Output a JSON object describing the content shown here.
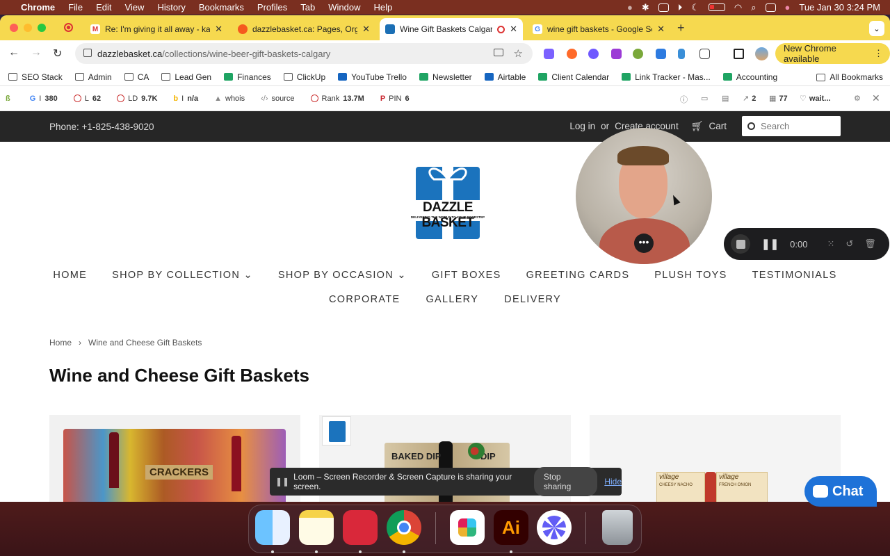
{
  "menubar": {
    "app": "Chrome",
    "items": [
      "File",
      "Edit",
      "View",
      "History",
      "Bookmarks",
      "Profiles",
      "Tab",
      "Window",
      "Help"
    ],
    "datetime": "Tue Jan 30  3:24 PM"
  },
  "tabs": [
    {
      "title": "Re: I'm giving it all away - kai",
      "icon": "gmail-icon"
    },
    {
      "title": "dazzlebasket.ca: Pages, Orga",
      "icon": "seo-tool-icon"
    },
    {
      "title": "Wine Gift Baskets Calgary",
      "icon": "dazzle-basket-icon"
    },
    {
      "title": "wine gift baskets - Google Se",
      "icon": "google-icon"
    }
  ],
  "address": {
    "domain": "dazzlebasket.ca",
    "path": "/collections/wine-beer-gift-baskets-calgary"
  },
  "new_chrome": "New Chrome available",
  "bookmarks": [
    "SEO Stack",
    "Admin",
    "CA",
    "Lead Gen",
    "Finances",
    "ClickUp",
    "YouTube Trello",
    "Newsletter",
    "Airtable",
    "Client Calendar",
    "Link Tracker - Mas...",
    "Accounting"
  ],
  "all_bookmarks": "All Bookmarks",
  "seobar": [
    {
      "label": "I",
      "value": "380"
    },
    {
      "label": "L",
      "value": "62"
    },
    {
      "label": "LD",
      "value": "9.7K"
    },
    {
      "label": "I",
      "value": "n/a"
    },
    {
      "label": "whois",
      "value": ""
    },
    {
      "label": "source",
      "value": ""
    },
    {
      "label": "Rank",
      "value": "13.7M"
    },
    {
      "label": "PIN",
      "value": "6"
    }
  ],
  "seobar_right": {
    "links": "2",
    "count": "77",
    "wait": "wait..."
  },
  "site": {
    "phone": "Phone: +1-825-438-9020",
    "login": "Log in",
    "or": "or",
    "create": "Create account",
    "cart": "Cart",
    "search_placeholder": "Search",
    "logo_text": "DAZZLE BASKET",
    "logo_tagline": "DELIVERING THE WORLD TO YOUR DOORSTEP",
    "nav_row1": [
      "HOME",
      "SHOP BY COLLECTION ⌄",
      "SHOP BY OCCASION ⌄",
      "GIFT BOXES",
      "GREETING CARDS",
      "PLUSH TOYS",
      "TESTIMONIALS"
    ],
    "nav_row2": [
      "CORPORATE",
      "GALLERY",
      "DELIVERY"
    ],
    "breadcrumb": [
      "Home",
      "›",
      "Wine and Cheese Gift Baskets"
    ],
    "title": "Wine and Cheese Gift Baskets",
    "product_texts": [
      "CRACKERS",
      "BAKED DIP",
      "DIP",
      "village",
      "CHEESY NACHO",
      "village",
      "FRENCH ONION"
    ]
  },
  "loom": {
    "timer": "0:00",
    "share_msg": "Loom – Screen Recorder & Screen Capture is sharing your screen.",
    "stop": "Stop sharing",
    "hide": "Hide"
  },
  "chat": "Chat"
}
